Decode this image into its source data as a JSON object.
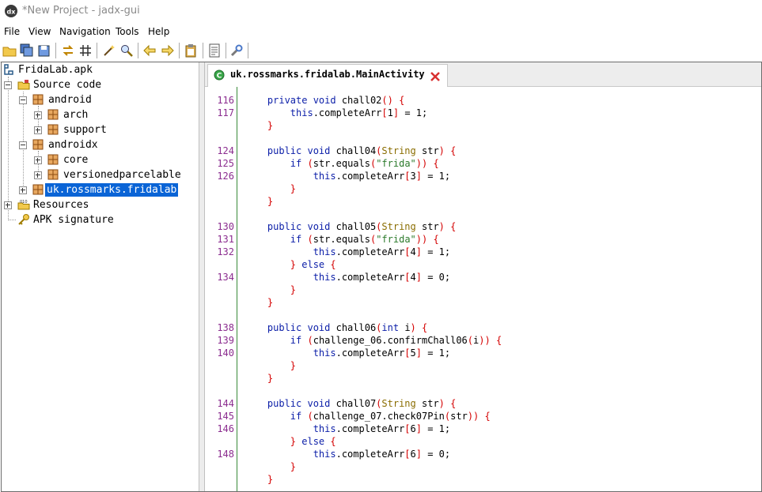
{
  "window": {
    "title": "*New Project - jadx-gui"
  },
  "menu": [
    "File",
    "View",
    "Navigation",
    "Tools",
    "Help"
  ],
  "toolbar": [
    "open-folder-icon",
    "save-all-icon",
    "export-icon",
    "sync-icon",
    "flatten-icon",
    "wand-icon",
    "search-icon",
    "back-icon",
    "forward-icon",
    "clipboard-icon",
    "log-icon",
    "settings-icon"
  ],
  "tree": {
    "root": "FridaLab.apk",
    "source_code": "Source code",
    "android": "android",
    "arch": "arch",
    "support": "support",
    "androidx": "androidx",
    "core": "core",
    "versionedparcelable": "versionedparcelable",
    "fridalab": "uk.rossmarks.fridalab",
    "resources": "Resources",
    "apk_signature": "APK signature"
  },
  "tab": {
    "label": "uk.rossmarks.fridalab.MainActivity"
  },
  "code": [
    {
      "ln": "116",
      "tokens": [
        [
          "kw",
          "    private void "
        ],
        [
          "pl",
          "chall02"
        ],
        [
          "pn",
          "() {"
        ]
      ]
    },
    {
      "ln": "117",
      "tokens": [
        [
          "kw",
          "        this"
        ],
        [
          "pl",
          ".completeArr"
        ],
        [
          "pn",
          "["
        ],
        [
          "pl",
          "1"
        ],
        [
          "pn",
          "]"
        ],
        [
          "pl",
          " = 1;"
        ]
      ]
    },
    {
      "ln": "",
      "tokens": [
        [
          "pn",
          "    }"
        ]
      ]
    },
    {
      "ln": "",
      "tokens": []
    },
    {
      "ln": "124",
      "tokens": [
        [
          "kw",
          "    public void "
        ],
        [
          "pl",
          "chall04"
        ],
        [
          "pn",
          "("
        ],
        [
          "ty",
          "String"
        ],
        [
          "pl",
          " str"
        ],
        [
          "pn",
          ") {"
        ]
      ]
    },
    {
      "ln": "125",
      "tokens": [
        [
          "kw",
          "        if "
        ],
        [
          "pn",
          "("
        ],
        [
          "pl",
          "str.equals"
        ],
        [
          "pn",
          "("
        ],
        [
          "str",
          "\"frida\""
        ],
        [
          "pn",
          ")) {"
        ]
      ]
    },
    {
      "ln": "126",
      "tokens": [
        [
          "kw",
          "            this"
        ],
        [
          "pl",
          ".completeArr"
        ],
        [
          "pn",
          "["
        ],
        [
          "pl",
          "3"
        ],
        [
          "pn",
          "]"
        ],
        [
          "pl",
          " = 1;"
        ]
      ]
    },
    {
      "ln": "",
      "tokens": [
        [
          "pn",
          "        }"
        ]
      ]
    },
    {
      "ln": "",
      "tokens": [
        [
          "pn",
          "    }"
        ]
      ]
    },
    {
      "ln": "",
      "tokens": []
    },
    {
      "ln": "130",
      "tokens": [
        [
          "kw",
          "    public void "
        ],
        [
          "pl",
          "chall05"
        ],
        [
          "pn",
          "("
        ],
        [
          "ty",
          "String"
        ],
        [
          "pl",
          " str"
        ],
        [
          "pn",
          ") {"
        ]
      ]
    },
    {
      "ln": "131",
      "tokens": [
        [
          "kw",
          "        if "
        ],
        [
          "pn",
          "("
        ],
        [
          "pl",
          "str.equals"
        ],
        [
          "pn",
          "("
        ],
        [
          "str",
          "\"frida\""
        ],
        [
          "pn",
          ")) {"
        ]
      ]
    },
    {
      "ln": "132",
      "tokens": [
        [
          "kw",
          "            this"
        ],
        [
          "pl",
          ".completeArr"
        ],
        [
          "pn",
          "["
        ],
        [
          "pl",
          "4"
        ],
        [
          "pn",
          "]"
        ],
        [
          "pl",
          " = 1;"
        ]
      ]
    },
    {
      "ln": "",
      "tokens": [
        [
          "pn",
          "        } "
        ],
        [
          "kw",
          "else "
        ],
        [
          "pn",
          "{"
        ]
      ]
    },
    {
      "ln": "134",
      "tokens": [
        [
          "kw",
          "            this"
        ],
        [
          "pl",
          ".completeArr"
        ],
        [
          "pn",
          "["
        ],
        [
          "pl",
          "4"
        ],
        [
          "pn",
          "]"
        ],
        [
          "pl",
          " = 0;"
        ]
      ]
    },
    {
      "ln": "",
      "tokens": [
        [
          "pn",
          "        }"
        ]
      ]
    },
    {
      "ln": "",
      "tokens": [
        [
          "pn",
          "    }"
        ]
      ]
    },
    {
      "ln": "",
      "tokens": []
    },
    {
      "ln": "138",
      "tokens": [
        [
          "kw",
          "    public void "
        ],
        [
          "pl",
          "chall06"
        ],
        [
          "pn",
          "("
        ],
        [
          "kw",
          "int"
        ],
        [
          "pl",
          " i"
        ],
        [
          "pn",
          ") {"
        ]
      ]
    },
    {
      "ln": "139",
      "tokens": [
        [
          "kw",
          "        if "
        ],
        [
          "pn",
          "("
        ],
        [
          "pl",
          "challenge_06.confirmChall06"
        ],
        [
          "pn",
          "("
        ],
        [
          "pl",
          "i"
        ],
        [
          "pn",
          ")) {"
        ]
      ]
    },
    {
      "ln": "140",
      "tokens": [
        [
          "kw",
          "            this"
        ],
        [
          "pl",
          ".completeArr"
        ],
        [
          "pn",
          "["
        ],
        [
          "pl",
          "5"
        ],
        [
          "pn",
          "]"
        ],
        [
          "pl",
          " = 1;"
        ]
      ]
    },
    {
      "ln": "",
      "tokens": [
        [
          "pn",
          "        }"
        ]
      ]
    },
    {
      "ln": "",
      "tokens": [
        [
          "pn",
          "    }"
        ]
      ]
    },
    {
      "ln": "",
      "tokens": []
    },
    {
      "ln": "144",
      "tokens": [
        [
          "kw",
          "    public void "
        ],
        [
          "pl",
          "chall07"
        ],
        [
          "pn",
          "("
        ],
        [
          "ty",
          "String"
        ],
        [
          "pl",
          " str"
        ],
        [
          "pn",
          ") {"
        ]
      ]
    },
    {
      "ln": "145",
      "tokens": [
        [
          "kw",
          "        if "
        ],
        [
          "pn",
          "("
        ],
        [
          "pl",
          "challenge_07.check07Pin"
        ],
        [
          "pn",
          "("
        ],
        [
          "pl",
          "str"
        ],
        [
          "pn",
          ")) {"
        ]
      ]
    },
    {
      "ln": "146",
      "tokens": [
        [
          "kw",
          "            this"
        ],
        [
          "pl",
          ".completeArr"
        ],
        [
          "pn",
          "["
        ],
        [
          "pl",
          "6"
        ],
        [
          "pn",
          "]"
        ],
        [
          "pl",
          " = 1;"
        ]
      ]
    },
    {
      "ln": "",
      "tokens": [
        [
          "pn",
          "        } "
        ],
        [
          "kw",
          "else "
        ],
        [
          "pn",
          "{"
        ]
      ]
    },
    {
      "ln": "148",
      "tokens": [
        [
          "kw",
          "            this"
        ],
        [
          "pl",
          ".completeArr"
        ],
        [
          "pn",
          "["
        ],
        [
          "pl",
          "6"
        ],
        [
          "pn",
          "]"
        ],
        [
          "pl",
          " = 0;"
        ]
      ]
    },
    {
      "ln": "",
      "tokens": [
        [
          "pn",
          "        }"
        ]
      ]
    },
    {
      "ln": "",
      "tokens": [
        [
          "pn",
          "    }"
        ]
      ]
    }
  ]
}
